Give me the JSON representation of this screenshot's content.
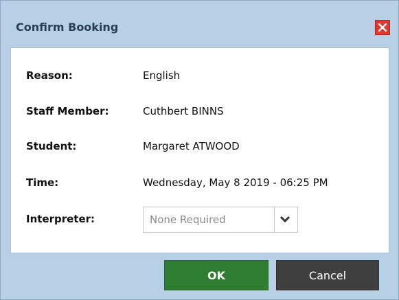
{
  "dialog": {
    "title": "Confirm Booking",
    "close_icon": "close-x-icon"
  },
  "fields": {
    "reason": {
      "label": "Reason:",
      "value": "English"
    },
    "staff_member": {
      "label": "Staff Member:",
      "value": "Cuthbert BINNS"
    },
    "student": {
      "label": "Student:",
      "value": "Margaret ATWOOD"
    },
    "time": {
      "label": "Time:",
      "value": "Wednesday, May 8 2019 - 06:25 PM"
    },
    "interpreter": {
      "label": "Interpreter:",
      "selected": "None Required"
    }
  },
  "buttons": {
    "ok_label": "OK",
    "cancel_label": "Cancel"
  },
  "colors": {
    "frame": "#b8d0e6",
    "title_text": "#2a3d52",
    "close": "#e0382f",
    "ok": "#2e7d32",
    "cancel": "#3f3f3f"
  }
}
